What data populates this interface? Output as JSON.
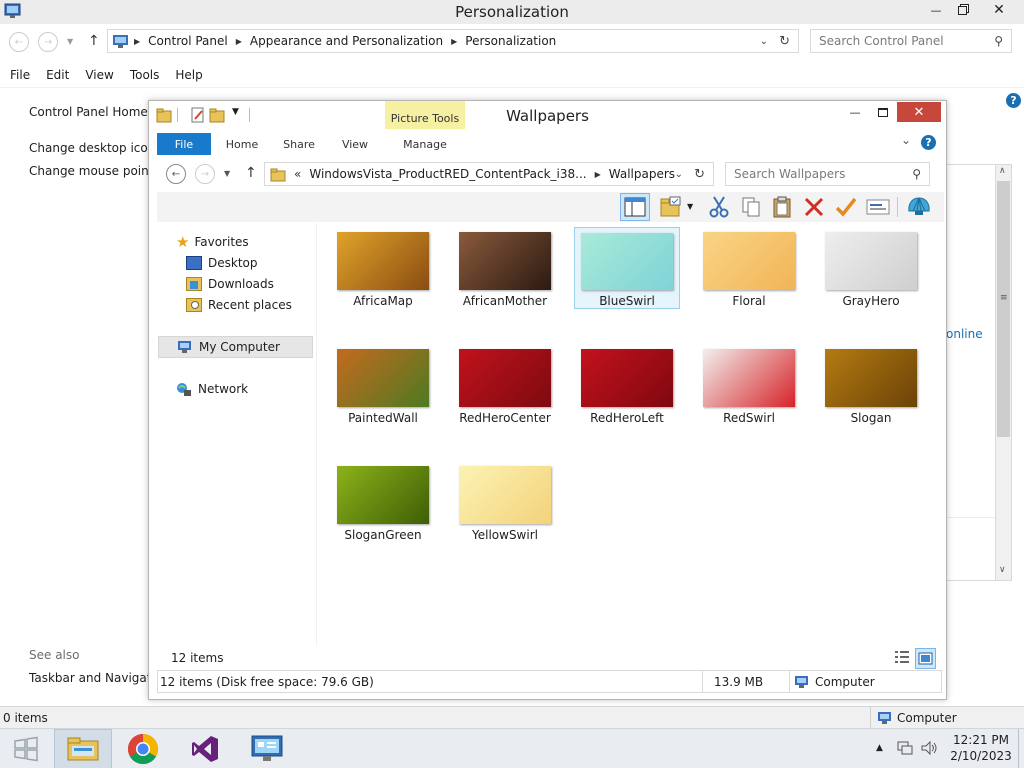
{
  "background_window": {
    "title": "Personalization",
    "breadcrumb": [
      "Control Panel",
      "Appearance and Personalization",
      "Personalization"
    ],
    "search_placeholder": "Search Control Panel",
    "menu": [
      "File",
      "Edit",
      "View",
      "Tools",
      "Help"
    ],
    "links": [
      "Control Panel Home",
      "Change desktop icons",
      "Change mouse pointers"
    ],
    "see_also": "See also",
    "see_also_links": [
      "Taskbar and Navigation"
    ],
    "partial_link": "online",
    "status_items": "0 items",
    "status_location": "Computer"
  },
  "wallpapers_window": {
    "title": "Wallpapers",
    "contextual_tab_group": "Picture Tools",
    "ribbon_tabs": [
      "File",
      "Home",
      "Share",
      "View",
      "Manage"
    ],
    "address_prefix": "«",
    "breadcrumb": [
      "WindowsVista_ProductRED_ContentPack_i38...",
      "Wallpapers"
    ],
    "search_placeholder": "Search Wallpapers",
    "nav": {
      "favorites": "Favorites",
      "favorites_items": [
        "Desktop",
        "Downloads",
        "Recent places"
      ],
      "my_computer": "My Computer",
      "network": "Network"
    },
    "files": [
      {
        "name": "AfricaMap",
        "swatch": [
          "#e0a32a",
          "#8a4d12"
        ]
      },
      {
        "name": "AfricanMother",
        "swatch": [
          "#8a5a3c",
          "#2b1a12"
        ]
      },
      {
        "name": "BlueSwirl",
        "swatch": [
          "#a8ead8",
          "#7fd3d8"
        ]
      },
      {
        "name": "Floral",
        "swatch": [
          "#f9d585",
          "#f2b458"
        ]
      },
      {
        "name": "GrayHero",
        "swatch": [
          "#eeeeee",
          "#cfcfcf"
        ]
      },
      {
        "name": "PaintedWall",
        "swatch": [
          "#c46a1e",
          "#4e7a22"
        ]
      },
      {
        "name": "RedHeroCenter",
        "swatch": [
          "#c0121c",
          "#7e0a10"
        ]
      },
      {
        "name": "RedHeroLeft",
        "swatch": [
          "#c3121d",
          "#80080f"
        ]
      },
      {
        "name": "RedSwirl",
        "swatch": [
          "#f2f0ec",
          "#d6232a"
        ]
      },
      {
        "name": "Slogan",
        "swatch": [
          "#b57b12",
          "#6a4307"
        ]
      },
      {
        "name": "SloganGreen",
        "swatch": [
          "#8cb21a",
          "#3e5e06"
        ]
      },
      {
        "name": "YellowSwirl",
        "swatch": [
          "#fbf3b4",
          "#f3d27a"
        ]
      }
    ],
    "selected_file": "BlueSwirl",
    "item_count": "12 items",
    "status_text": "12 items (Disk free space: 79.6 GB)",
    "status_size": "13.9 MB",
    "status_location": "Computer"
  },
  "taskbar": {
    "clock_time": "12:21 PM",
    "clock_date": "2/10/2023"
  },
  "colors": {
    "file_tab": "#1979ca",
    "picture_tools": "#f6f0a2",
    "close_red": "#c7473a",
    "link_blue": "#1a6fb3"
  }
}
